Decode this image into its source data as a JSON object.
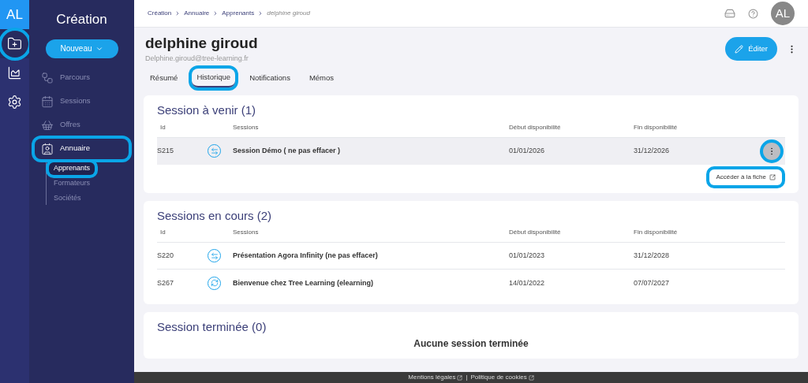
{
  "logo": "AL",
  "rail": [
    {
      "selected": true,
      "highlighted": true
    },
    {
      "selected": false,
      "highlighted": false
    },
    {
      "selected": false,
      "highlighted": false
    }
  ],
  "sidebar": {
    "title": "Création",
    "new_button": "Nouveau",
    "items": [
      {
        "label": "Parcours",
        "selected": false,
        "highlighted": false
      },
      {
        "label": "Sessions",
        "selected": false,
        "highlighted": false
      },
      {
        "label": "Offres",
        "selected": false,
        "highlighted": false
      },
      {
        "label": "Annuaire",
        "selected": true,
        "highlighted": true,
        "children": [
          {
            "label": "Apprenants",
            "selected": true,
            "highlighted": true
          },
          {
            "label": "Formateurs",
            "selected": false,
            "highlighted": false
          },
          {
            "label": "Sociétés",
            "selected": false,
            "highlighted": false
          }
        ]
      }
    ]
  },
  "breadcrumb": [
    "Création",
    "Annuaire",
    "Apprenants"
  ],
  "breadcrumb_current": "delphine giroud",
  "avatar": "AL",
  "person": {
    "name": "delphine giroud",
    "email": "Delphine.giroud@tree-learning.fr"
  },
  "edit_button": "Éditer",
  "tabs": [
    {
      "label": "Résumé",
      "selected": false,
      "highlighted": false
    },
    {
      "label": "Historique",
      "selected": true,
      "highlighted": true
    },
    {
      "label": "Notifications",
      "selected": false,
      "highlighted": false
    },
    {
      "label": "Mémos",
      "selected": false,
      "highlighted": false
    }
  ],
  "sections": [
    {
      "title": "Session à venir (1)",
      "columns": [
        "Id",
        "Sessions",
        "Début disponibilité",
        "Fin disponibilité"
      ],
      "rows": [
        {
          "id": "S215",
          "kind": "swap",
          "name": "Session Démo ( ne pas effacer )",
          "start": "01/01/2026",
          "end": "31/12/2026",
          "hovered": true,
          "menu_highlighted": true,
          "link": "Accéder à la fiche",
          "link_highlighted": true
        }
      ]
    },
    {
      "title": "Sessions en cours (2)",
      "columns": [
        "Id",
        "Sessions",
        "Début disponibilité",
        "Fin disponibilité"
      ],
      "rows": [
        {
          "id": "S220",
          "kind": "swap",
          "name": "Présentation Agora Infinity (ne pas effacer)",
          "start": "01/01/2023",
          "end": "31/12/2028",
          "hovered": false
        },
        {
          "id": "S267",
          "kind": "cycle",
          "name": "Bienvenue chez Tree Learning (elearning)",
          "start": "14/01/2022",
          "end": "07/07/2027",
          "hovered": false
        }
      ]
    },
    {
      "title": "Session terminée (0)",
      "empty_message": "Aucune session terminée"
    }
  ],
  "footer": {
    "links": [
      "Mentions légales",
      "Politique de cookies"
    ],
    "separator": "|"
  }
}
